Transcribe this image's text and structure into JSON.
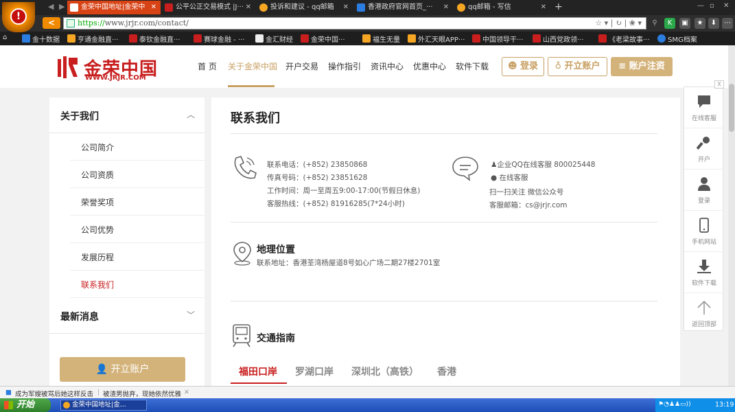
{
  "browser": {
    "tabs": [
      {
        "label": "金荣中国地址|金荣中",
        "color": "#c81e1e",
        "active": true
      },
      {
        "label": "公平公正交易模式 |J···",
        "color": "#c81e1e",
        "active": false
      },
      {
        "label": "投诉和建议 - qq邮箱",
        "color": "#f5a623",
        "active": false
      },
      {
        "label": "香港政府官网首页_···",
        "color": "#2b7de0",
        "active": false
      },
      {
        "label": "qq邮箱 - 写信",
        "color": "#f5a623",
        "active": false
      }
    ],
    "url_scheme": "https://",
    "url_host": "www.jrjr.com",
    "url_path": "/contact/",
    "bookmarks": [
      {
        "label": "金十数据",
        "color": "#2b7de0"
      },
      {
        "label": "亨通金融直···",
        "color": "#f5a623"
      },
      {
        "label": "泰钦金融直···",
        "color": "#c81e1e"
      },
      {
        "label": "赛球金融 - ···",
        "color": "#c81e1e"
      },
      {
        "label": "金汇财经",
        "color": "#eeeeee"
      },
      {
        "label": "金荣中国···",
        "color": "#c81e1e"
      },
      {
        "label": "福生无量",
        "color": "#f5a623"
      },
      {
        "label": "外汇天眼APP···",
        "color": "#f5a623"
      },
      {
        "label": "中国领导干···",
        "color": "#c81e1e"
      },
      {
        "label": "山西党政领···",
        "color": "#c81e1e"
      },
      {
        "label": "《老梁故事···",
        "color": "#c81e1e"
      },
      {
        "label": "SMG档案",
        "color": "#2b7de0"
      }
    ]
  },
  "site": {
    "logo_cn": "金荣中国",
    "logo_en": "WWW.JRJR.COM",
    "nav": [
      "首 页",
      "关于金荣中国",
      "开户交易",
      "操作指引",
      "资讯中心",
      "优惠中心",
      "软件下载"
    ],
    "login_label": "登录",
    "open_account_label": "开立账户",
    "account_register_label": "账户注资"
  },
  "sidebar": {
    "section1_title": "关于我们",
    "items": [
      "公司简介",
      "公司资质",
      "荣誉奖项",
      "公司优势",
      "发展历程",
      "联系我们"
    ],
    "section2_title": "最新消息",
    "open_account_label": "开立账户"
  },
  "main": {
    "title": "联系我们",
    "contact_left": [
      "联系电话：(+852) 23850868",
      "传真号码：(+852) 23851628",
      "工作时间：周一至周五9:00-17:00(节假日休息)",
      "客服热线：(+852) 81916285(7*24小时)"
    ],
    "contact_right": [
      "企业QQ在线客服 800025448",
      "在线客服",
      "扫一扫关注 微信公众号",
      "客服邮箱：cs@jrjr.com"
    ],
    "location_title": "地理位置",
    "location_address": "联系地址：香港荃湾杨屋道8号如心广场二期27楼2701室",
    "traffic_title": "交通指南",
    "traffic_tabs": [
      "福田口岸",
      "罗湖口岸",
      "深圳北（高铁）",
      "香港"
    ]
  },
  "floatbar": {
    "items": [
      "在线客服",
      "开户",
      "登录",
      "手机网站",
      "软件下载",
      "返回顶部"
    ],
    "close": "X"
  },
  "statusbar": {
    "news1": "成为军嫂被骂后她这样反击",
    "news2": "被渣男抛弃，现她依然优雅"
  },
  "taskbar": {
    "start_label": "开始",
    "task_label": "金荣中国地址|金...",
    "clock": "13:19"
  },
  "colors": {
    "brand_red": "#c81e1e",
    "brand_gold": "#c8a063",
    "gold_fill": "#d4b37b"
  }
}
